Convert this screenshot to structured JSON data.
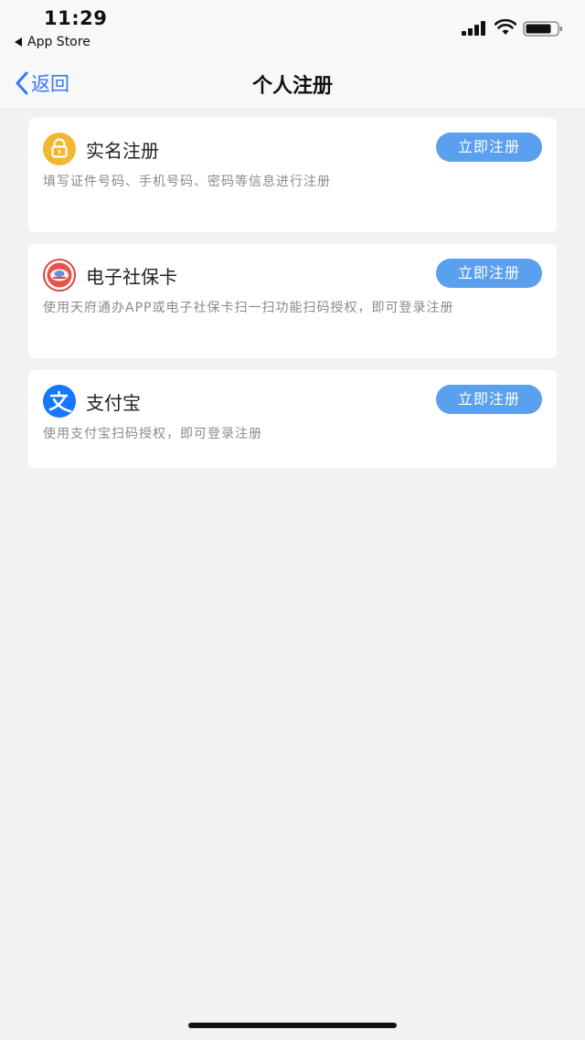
{
  "status_bar": {
    "time": "11:29",
    "back_app_label": "App Store"
  },
  "nav": {
    "back_label": "返回",
    "title": "个人注册"
  },
  "options": [
    {
      "icon": "lock-icon",
      "title": "实名注册",
      "button": "立即注册",
      "description": "填写证件号码、手机号码、密码等信息进行注册"
    },
    {
      "icon": "social-security-card-icon",
      "title": "电子社保卡",
      "button": "立即注册",
      "description": "使用天府通办APP或电子社保卡扫一扫功能扫码授权，即可登录注册"
    },
    {
      "icon": "alipay-icon",
      "title": "支付宝",
      "button": "立即注册",
      "description": "使用支付宝扫码授权，即可登录注册"
    }
  ],
  "colors": {
    "accent": "#3478f6",
    "button": "#5aa0ee",
    "background": "#f2f2f4",
    "lock_icon": "#f2b630",
    "alipay_icon": "#1677ff",
    "social_card_icon": "#d9473f"
  }
}
